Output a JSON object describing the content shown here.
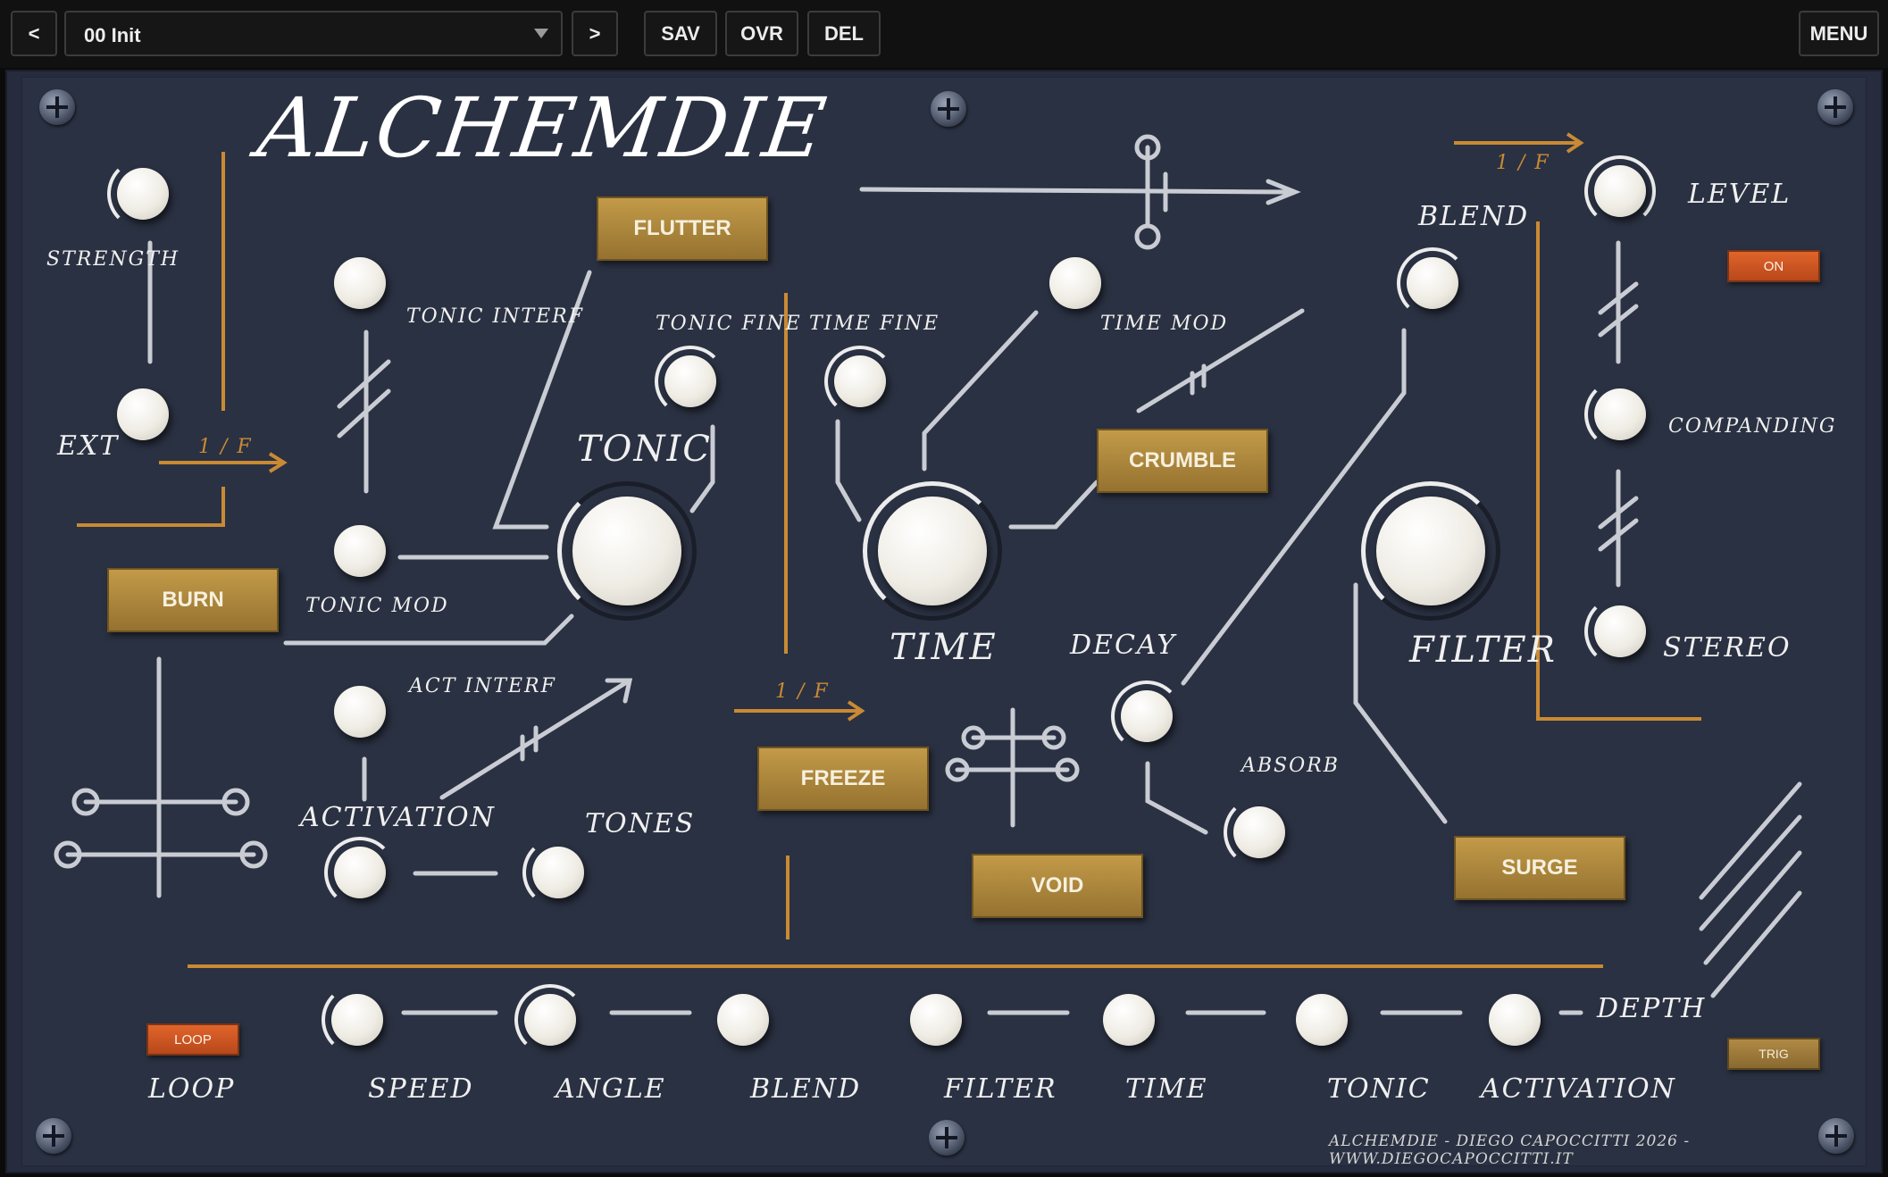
{
  "topbar": {
    "prev_label": "<",
    "preset_name": "00 Init",
    "next_label": ">",
    "save_label": "SAV",
    "overwrite_label": "OVR",
    "delete_label": "DEL",
    "menu_label": "MENU"
  },
  "panel": {
    "logo": "ALCHEMDIE",
    "credit": "ALCHEMDIE - DIEGO CAPOCCITTI 2026 - WWW.DIEGOCAPOCCITTI.IT",
    "arrow_labels": [
      "1 / F",
      "1 / F",
      "1 / F"
    ],
    "buttons": {
      "flutter": "FLUTTER",
      "burn": "BURN",
      "crumble": "CRUMBLE",
      "freeze": "FREEZE",
      "void": "VOID",
      "surge": "SURGE",
      "on": "ON",
      "loop": "LOOP",
      "trig": "TRIG"
    },
    "labels": {
      "strength": "STRENGTH",
      "ext": "EXT",
      "tonic_interf": "TONIC INTERF",
      "tonic_mod": "TONIC MOD",
      "tonic_fine": "TONIC FINE",
      "tonic": "TONIC",
      "time_fine": "TIME FINE",
      "time_mod": "TIME MOD",
      "time": "TIME",
      "blend": "BLEND",
      "filter": "FILTER",
      "level": "LEVEL",
      "companding": "COMPANDING",
      "stereo": "STEREO",
      "decay": "DECAY",
      "absorb": "ABSORB",
      "act_interf": "ACT INTERF",
      "activation": "ACTIVATION",
      "tones": "TONES"
    },
    "bottom_labels": {
      "loop": "LOOP",
      "speed": "SPEED",
      "angle": "ANGLE",
      "blend": "BLEND",
      "filter": "FILTER",
      "time": "TIME",
      "tonic": "TONIC",
      "activation": "ACTIVATION",
      "depth": "DEPTH"
    }
  },
  "colors": {
    "panel": "#2a3142",
    "gold_button": "#b48c40",
    "orange_button": "#d45a22",
    "orange_line": "#c98a34",
    "line": "#c9ccd3"
  }
}
